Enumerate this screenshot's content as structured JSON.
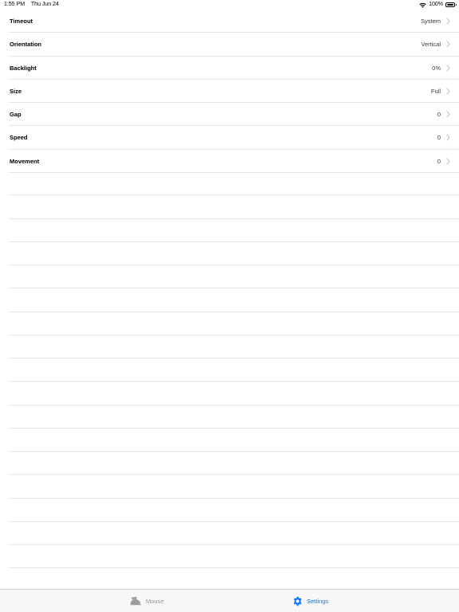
{
  "status_bar": {
    "time": "1:55 PM",
    "date": "Thu Jun 24",
    "battery": "100%",
    "battery_level": 1.0,
    "icons": [
      "wifi-icon",
      "battery-icon"
    ]
  },
  "settings": {
    "rows": [
      {
        "label": "Timeout",
        "value": "System"
      },
      {
        "label": "Orientation",
        "value": "Vertical"
      },
      {
        "label": "Backlight",
        "value": "0%"
      },
      {
        "label": "Size",
        "value": "Full"
      },
      {
        "label": "Gap",
        "value": "0"
      },
      {
        "label": "Speed",
        "value": "0"
      },
      {
        "label": "Movement",
        "value": "0"
      }
    ],
    "row_icon": "chevron-right-icon"
  },
  "tab_bar": {
    "tabs": [
      {
        "label": "Mouse",
        "icon": "mouse-icon",
        "selected": false
      },
      {
        "label": "Settings",
        "icon": "gear-icon",
        "selected": true
      }
    ],
    "colors": {
      "selected": "#0a7aff",
      "unselected": "#9a9a9f"
    }
  }
}
